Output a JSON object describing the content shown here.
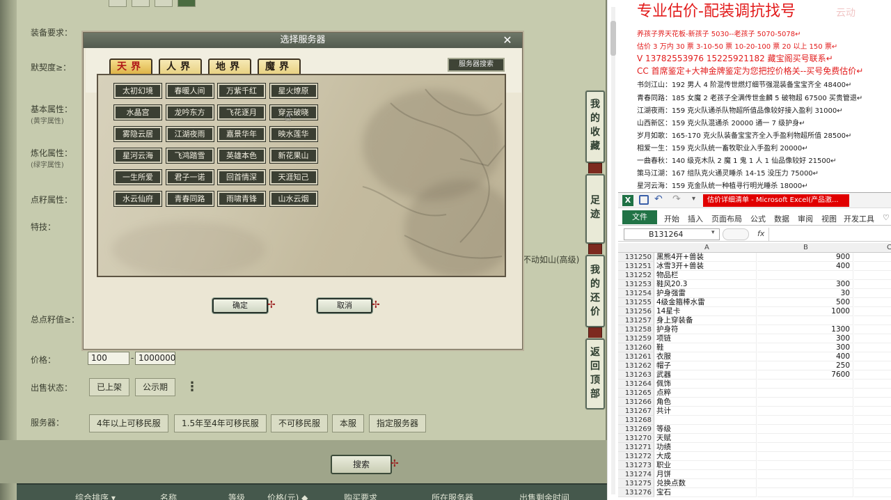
{
  "game": {
    "labels": {
      "equip_req": "装备要求：",
      "tacit": "默契度≥：",
      "basic_attr": "基本属性：",
      "basic_sub": "(黄字属性)",
      "refine_attr": "炼化属性：",
      "refine_sub": "(绿字属性)",
      "point_attr": "点籽属性：",
      "skill": "特技：",
      "total_points": "总点籽值≥：",
      "price": "价格：",
      "sale_status": "出售状态：",
      "server": "服务器："
    },
    "skill_tag": "不动如山(高级)",
    "price_min": "100",
    "price_dash": "-",
    "price_max": "1000000",
    "sale_status_options": [
      "已上架",
      "公示期"
    ],
    "more_icon": "⋮",
    "server_options": [
      "4年以上可移民服",
      "1.5年至4年可移民服",
      "不可移民服",
      "本服",
      "指定服务器"
    ],
    "search_label": "搜索",
    "table_headers": [
      "综合排序 ▾",
      "名称",
      "等级",
      "价格(元) ◆",
      "购买要求",
      "所在服务器",
      "出售剩余时间"
    ],
    "side_nav": [
      {
        "label": "我的收藏"
      },
      {
        "label": "足迹"
      },
      {
        "label": "我的还价"
      },
      {
        "label": "返回顶部"
      }
    ]
  },
  "dialog": {
    "title": "选择服务器",
    "close": "✕",
    "tabs": [
      "天界",
      "人界",
      "地界",
      "魔界"
    ],
    "active_tab": 0,
    "server_search": "服务器搜索",
    "servers": [
      [
        "太初幻境",
        "春暖人间",
        "万紫千红",
        "星火燎原"
      ],
      [
        "水晶宫",
        "龙吟东方",
        "飞花逐月",
        "穿云破晓"
      ],
      [
        "雾隐云居",
        "江湖夜雨",
        "嘉景华年",
        "映水莲华"
      ],
      [
        "星河云海",
        "飞鸿踏雪",
        "英雄本色",
        "新花果山"
      ],
      [
        "一生所爱",
        "君子一诺",
        "回首情深",
        "天涯知己"
      ],
      [
        "水云仙府",
        "青春同路",
        "雨啸青锋",
        "山水云烟"
      ]
    ],
    "confirm": "确定",
    "cancel": "取消"
  },
  "note": {
    "title": "专业估价-配装调抗找号",
    "watermark": "云动",
    "red_lines": [
      "养孩子界天花板-新孩子 5030--老孩子 5070-5078↵",
      "估价 3 万内 30 票    3-10-50 票    10-20-100 票    20 以上 150 票↵",
      "V 13782553976    15225921182    藏宝阁买号联系↵",
      "CC 首席鉴定+大神金牌鉴定为您把控价格关--买号免费估价↵"
    ],
    "black_lines": [
      "书剑江山：192 男人 4 阶混传世燃灯细节强混装备宝宝齐全 48400↵",
      "青春同路：185 女魔 2 老孩子全满传世金麟 5 破物超 67500 买贵管退↵",
      "江湖夜雨：159 克火队通杀队物超所值品像较好接入盈利 31000↵",
      "山西新区：159 克火队混通杀 20000 通一 7 级护身↵",
      "岁月如歌：165-170 克火队装备宝宝齐全入手盈利物超所值 28500↵",
      "相爱一生：159 克火队统一畜牧职业入手盈利 20000↵",
      "一曲春秋：140 级克木队 2 魔 1 鬼 1 人 1 仙品像较好 21500↵",
      "策马江湖：167 组队克火通灵睡杀 14-15 没压力 75000↵",
      "星河云海：159 克金队统一种植寻行明光睡杀 18000↵"
    ]
  },
  "excel": {
    "title": "估价详细清单 - Microsoft Excel(产品激...",
    "qat_icons": [
      "excel-logo-icon",
      "save-icon",
      "undo-icon",
      "redo-icon"
    ],
    "tabs": [
      "文件",
      "开始",
      "插入",
      "页面布局",
      "公式",
      "数据",
      "审阅",
      "视图",
      "开发工具"
    ],
    "name_box": "B131264",
    "fx": "fx",
    "columns": [
      "A",
      "B",
      "C"
    ],
    "rows": [
      {
        "n": "131250",
        "a": "黑熊4开+兽装",
        "b": "900"
      },
      {
        "n": "131251",
        "a": "冰雪3开+兽装",
        "b": "400"
      },
      {
        "n": "131252",
        "a": "物品栏",
        "b": ""
      },
      {
        "n": "131253",
        "a": "鞋风20.3",
        "b": "300"
      },
      {
        "n": "131254",
        "a": "护身强雷",
        "b": "30"
      },
      {
        "n": "131255",
        "a": "4级金箍棒水雷",
        "b": "500"
      },
      {
        "n": "131256",
        "a": "14星卡",
        "b": "1000"
      },
      {
        "n": "131257",
        "a": "身上穿装备",
        "b": ""
      },
      {
        "n": "131258",
        "a": "护身符",
        "b": "1300"
      },
      {
        "n": "131259",
        "a": "项链",
        "b": "300"
      },
      {
        "n": "131260",
        "a": "鞋",
        "b": "300"
      },
      {
        "n": "131261",
        "a": "衣服",
        "b": "400"
      },
      {
        "n": "131262",
        "a": "帽子",
        "b": "250"
      },
      {
        "n": "131263",
        "a": "武器",
        "b": "7600"
      },
      {
        "n": "131264",
        "a": "佩饰",
        "b": ""
      },
      {
        "n": "131265",
        "a": "点粹",
        "b": ""
      },
      {
        "n": "131266",
        "a": "角色",
        "b": ""
      },
      {
        "n": "131267",
        "a": "共计",
        "b": ""
      },
      {
        "n": "131268",
        "a": "",
        "b": ""
      },
      {
        "n": "131269",
        "a": "等级",
        "b": ""
      },
      {
        "n": "131270",
        "a": "天赋",
        "b": ""
      },
      {
        "n": "131271",
        "a": "功绩",
        "b": ""
      },
      {
        "n": "131272",
        "a": "大成",
        "b": ""
      },
      {
        "n": "131273",
        "a": "职业",
        "b": ""
      },
      {
        "n": "131274",
        "a": "月饼",
        "b": ""
      },
      {
        "n": "131275",
        "a": "兑换点数",
        "b": ""
      },
      {
        "n": "131276",
        "a": "宝石",
        "b": ""
      }
    ]
  }
}
